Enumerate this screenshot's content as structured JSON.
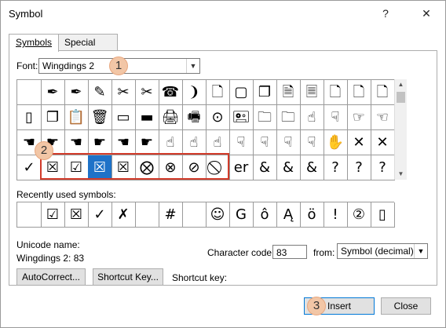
{
  "window": {
    "title": "Symbol",
    "help_icon": "?",
    "close_icon": "✕"
  },
  "tabs": [
    {
      "label": "Symbols",
      "active": true
    },
    {
      "label": "Special Characters",
      "active": false
    }
  ],
  "font": {
    "label": "Font:",
    "value": "Wingdings 2"
  },
  "callouts": [
    "1",
    "2",
    "3"
  ],
  "grid": {
    "rows": [
      [
        "",
        "✒",
        "✒",
        "✎",
        "✂",
        "✂",
        "☎",
        "❩",
        "🗋",
        "▢",
        "❐",
        "🗎",
        "🗏",
        "🗋",
        "🗋",
        "🗋"
      ],
      [
        "▯",
        "❐",
        "📋",
        "🗑",
        "▭",
        "▬",
        "🖨",
        "🖷",
        "⊙",
        "🖭",
        "🗀",
        "🗀",
        "☝",
        "☟",
        "☞",
        "☜"
      ],
      [
        "☚",
        "☛",
        "☚",
        "☛",
        "☚",
        "☛",
        "☝",
        "☝",
        "☝",
        "☟",
        "☟",
        "☟",
        "☟",
        "✋",
        "✕",
        "✕"
      ],
      [
        "✓",
        "☒",
        "☑",
        "☒",
        "☒",
        "⨂",
        "⊗",
        "⊘",
        "⃠",
        "er",
        "&",
        "&",
        "&",
        "?",
        "?",
        "?"
      ]
    ],
    "selected": {
      "row": 3,
      "col": 3
    }
  },
  "recent": {
    "label": "Recently used symbols:",
    "items": [
      "",
      "☑",
      "☒",
      "✓",
      "✗",
      "",
      "#",
      "",
      "☺",
      "G",
      "ô",
      "Ą",
      "ö",
      "!",
      "②",
      "▯"
    ]
  },
  "unicode": {
    "name_label": "Unicode name:",
    "name_value": "Wingdings 2: 83"
  },
  "charcode": {
    "label": "Character code:",
    "value": "83",
    "from_label": "from:",
    "from_value": "Symbol (decimal)"
  },
  "buttons": {
    "autocorrect": "AutoCorrect...",
    "shortcut_key": "Shortcut Key...",
    "shortcut_label": "Shortcut key:",
    "insert": "Insert",
    "close": "Close"
  }
}
